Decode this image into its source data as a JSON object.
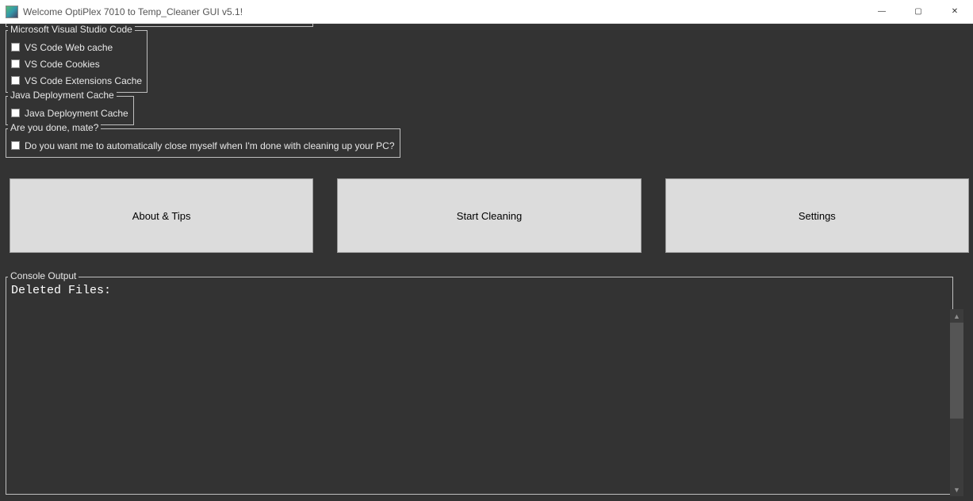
{
  "window": {
    "title": "Welcome OptiPlex 7010 to Temp_Cleaner GUI v5.1!",
    "controls": {
      "minimize": "—",
      "maximize": "▢",
      "close": "✕"
    }
  },
  "groups": {
    "vscode": {
      "legend": "Microsoft Visual Studio Code",
      "items": [
        {
          "label": "VS Code Web cache"
        },
        {
          "label": "VS Code Cookies"
        },
        {
          "label": "VS Code Extensions Cache"
        }
      ]
    },
    "java": {
      "legend": "Java Deployment Cache",
      "items": [
        {
          "label": "Java Deployment Cache"
        }
      ]
    },
    "done": {
      "legend": "Are you done, mate?",
      "items": [
        {
          "label": "Do you want me to automatically close myself when I'm done with cleaning up your PC?"
        }
      ]
    }
  },
  "buttons": {
    "about": "About & Tips",
    "start": "Start Cleaning",
    "settings": "Settings"
  },
  "console": {
    "legend": "Console Output",
    "text": "Deleted Files:"
  }
}
